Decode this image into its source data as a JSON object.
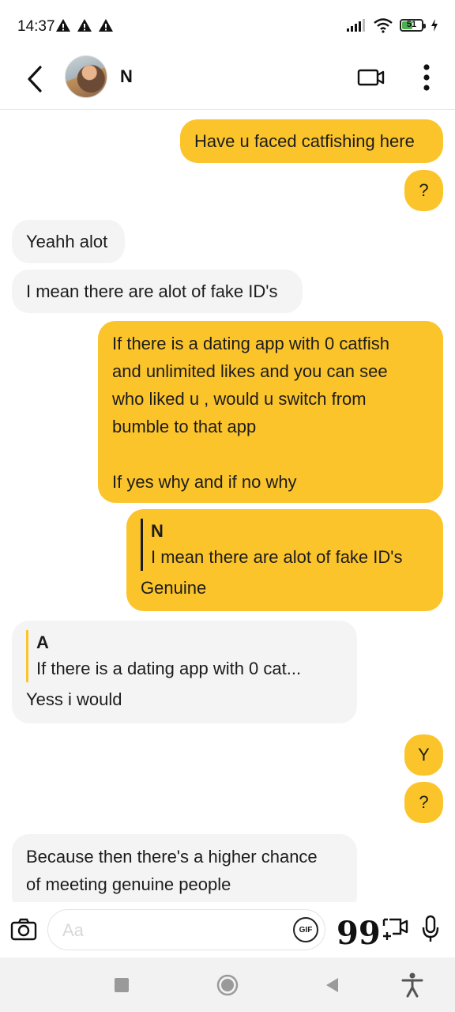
{
  "status_bar": {
    "time": "14:37",
    "battery": "51"
  },
  "header": {
    "contact_name": "N"
  },
  "messages": [
    {
      "id": 0,
      "sender": "me",
      "text": "Have u faced catfishing here"
    },
    {
      "id": 1,
      "sender": "me",
      "text": "?"
    },
    {
      "id": 2,
      "sender": "them",
      "text": "Yeahh alot"
    },
    {
      "id": 3,
      "sender": "them",
      "text": "I mean there are alot of fake ID's"
    },
    {
      "id": 4,
      "sender": "me",
      "lines": [
        "If there is a dating app with 0 catfish",
        "and unlimited likes and you can see",
        "who liked u , would u switch from",
        "bumble to that app",
        "",
        "If yes why and if no why"
      ]
    },
    {
      "id": 5,
      "sender": "me",
      "reply_to": {
        "name": "N",
        "text": "I mean there are alot of fake ID's"
      },
      "text": "Genuine"
    },
    {
      "id": 6,
      "sender": "them",
      "reply_to": {
        "name": "A",
        "text": "If there is a dating app with 0 cat..."
      },
      "text": "Yess i would"
    },
    {
      "id": 7,
      "sender": "me",
      "text": "Y"
    },
    {
      "id": 8,
      "sender": "me",
      "text": "?"
    },
    {
      "id": 9,
      "sender": "them",
      "lines": [
        "Because then there's a higher chance",
        "of meeting genuine people"
      ]
    }
  ],
  "composer": {
    "placeholder": "Aa",
    "value": "",
    "gif_label": "GIF",
    "quote_glyph": "99"
  },
  "colors": {
    "outgoing_bubble": "#fcc42b",
    "incoming_bubble": "#f4f4f4",
    "battery_fill": "#4caf50"
  }
}
